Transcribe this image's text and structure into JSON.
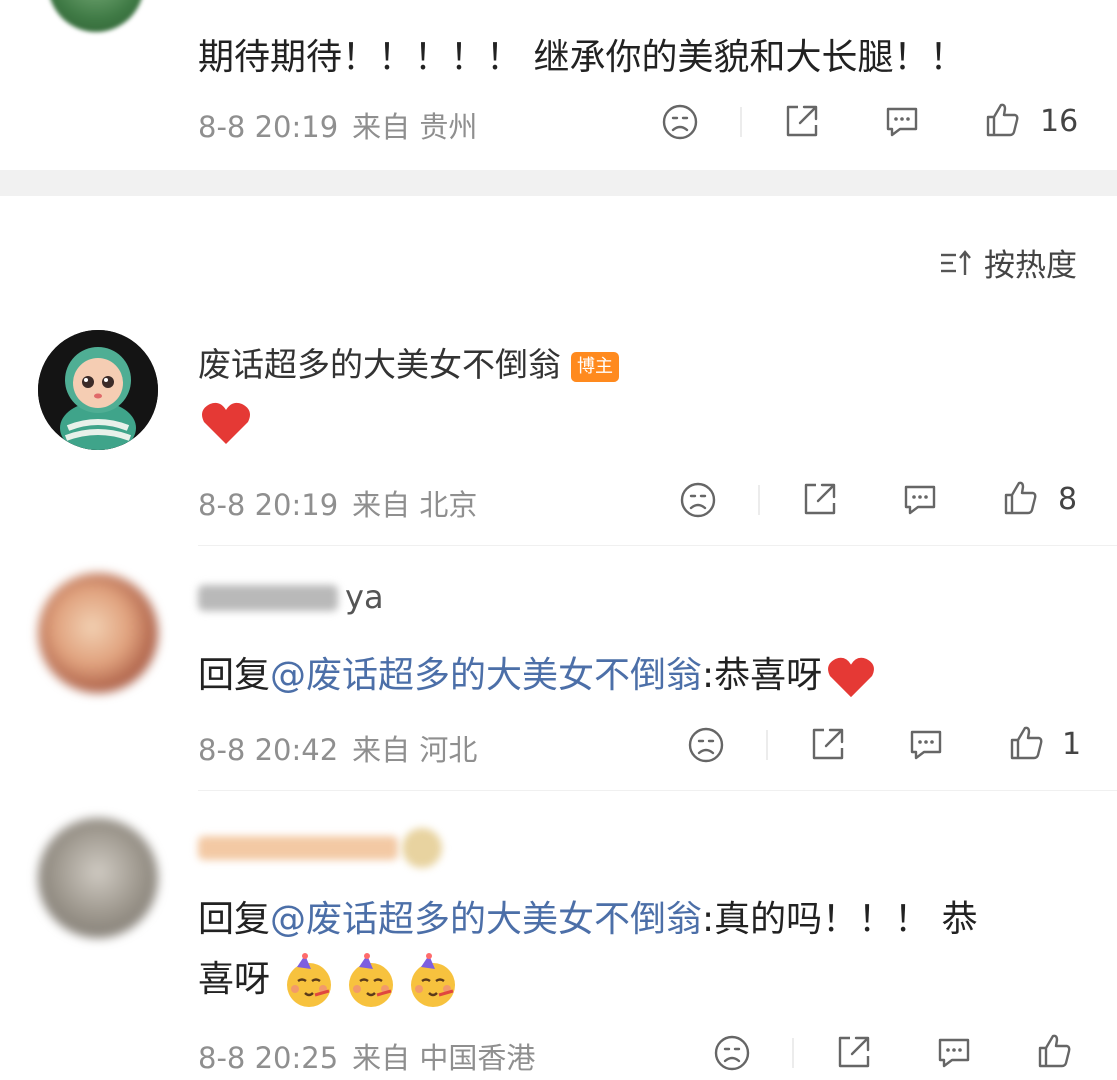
{
  "top_comment": {
    "text": "期待期待！！！！！ 继承你的美貌和大长腿！！",
    "time": "8-8 20:19",
    "location": "来自 贵州",
    "likes": "16"
  },
  "sort": {
    "label": "按热度"
  },
  "blogger_comment": {
    "nickname": "废话超多的大美女不倒翁",
    "badge": "博主",
    "time": "8-8 20:19",
    "location": "来自 北京",
    "likes": "8"
  },
  "reply1": {
    "nickname_suffix": "ya",
    "reply_prefix": "回复",
    "mention": "@废话超多的大美女不倒翁",
    "text": ":恭喜呀",
    "time": "8-8 20:42",
    "location": "来自 河北",
    "likes": "1"
  },
  "reply2": {
    "reply_prefix": "回复",
    "mention": "@废话超多的大美女不倒翁",
    "text_line1": ":真的吗！！！ 恭",
    "text_line2": "喜呀",
    "time": "8-8 20:25",
    "location": "来自 中国香港"
  },
  "colors": {
    "link": "#4c6fa8",
    "meta": "#8f8f8f",
    "badge": "#ff8a1e",
    "heart": "#e53935"
  },
  "icons": [
    "dislike-icon",
    "share-icon",
    "comment-icon",
    "like-icon",
    "sort-icon",
    "heart-emoji",
    "party-face-emoji"
  ]
}
